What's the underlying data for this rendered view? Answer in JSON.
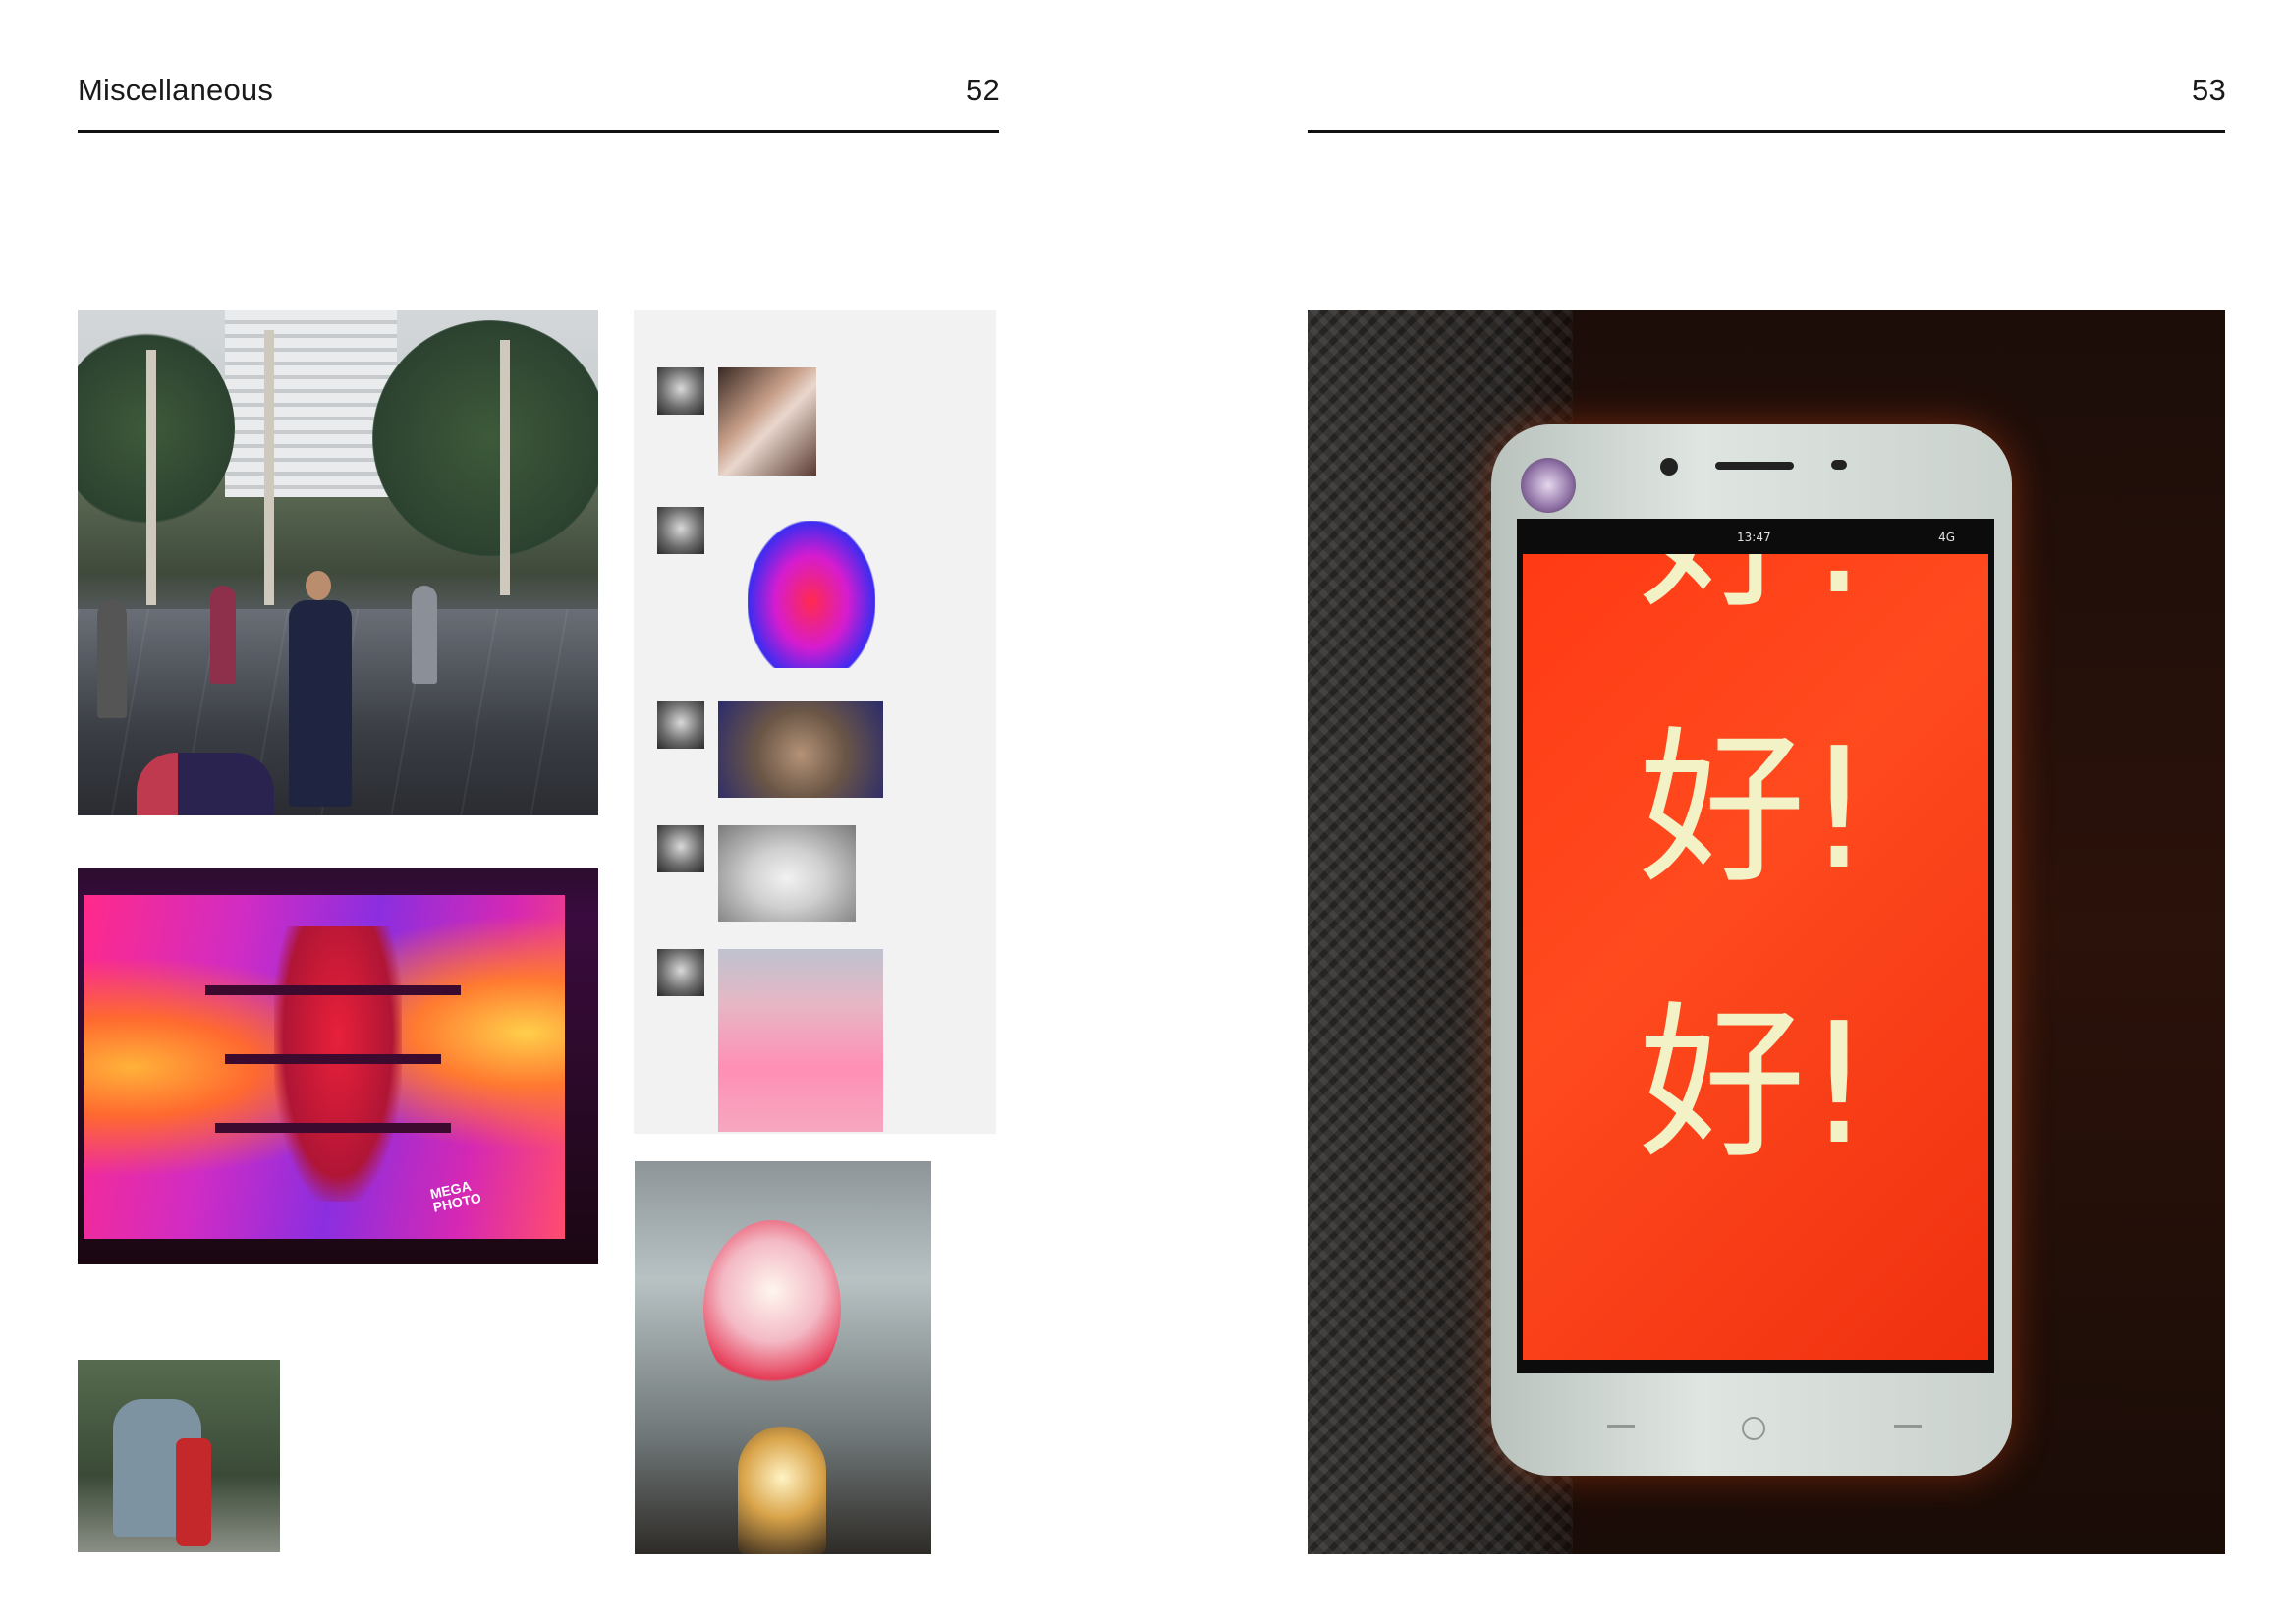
{
  "left_page": {
    "section_title": "Miscellaneous",
    "page_number": "52"
  },
  "right_page": {
    "page_number": "53"
  },
  "photos": {
    "neon_screen_logo": "MEGA\nPHOTO",
    "phone": {
      "status_time": "13:47",
      "status_network": "4G",
      "screen_lines": [
        "好!",
        "好!",
        "好!"
      ]
    }
  },
  "chat": {
    "stickers": [
      "girls-photo",
      "rainbow-frog",
      "surprised-cat",
      "owl",
      "pink-cat"
    ]
  }
}
